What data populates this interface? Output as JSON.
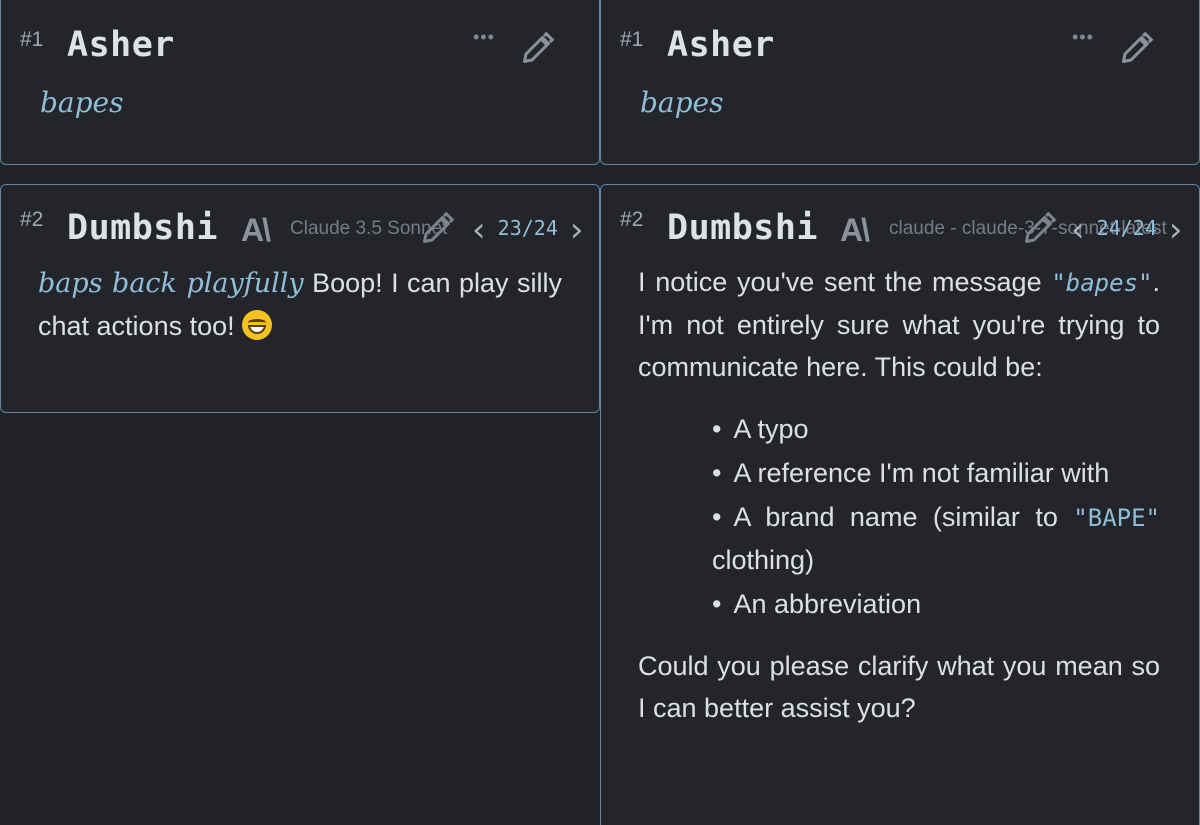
{
  "messages": [
    {
      "index": "#1",
      "author": "Asher",
      "text": "bapes",
      "more_label": "•••"
    },
    {
      "index": "#2",
      "author": "Dumbshi",
      "left": {
        "model_logo": "A\\",
        "model": "Claude 3.5 Sonnet",
        "nav": "23/24",
        "action": "baps back playfully",
        "text": "Boop! I can play silly chat actions too!"
      },
      "right": {
        "model_logo": "A\\",
        "model": "claude - claude-3-7-sonnet-latest",
        "nav": "24/24",
        "intro_1": "I notice you've sent the message ",
        "intro_code": "\"bapes\"",
        "intro_2": ". I'm not entirely sure what you're trying to communicate here. This could be:",
        "bullets": [
          "A typo",
          "A reference I'm not familiar with",
          "A brand name (similar to ",
          "An abbreviation"
        ],
        "bullet_code": "\"BAPE\"",
        "bullet_code_after": " clothing)",
        "closing": "Could you please clarify what you mean so I can better assist you?"
      }
    }
  ],
  "icons": {
    "edit": "pencil-icon",
    "more": "more-options-icon",
    "prev": "chevron-left-icon",
    "next": "chevron-right-icon",
    "emoji": "grinning-face-emoji"
  },
  "colors": {
    "background": "#23232a",
    "card_border": "#5f86a6",
    "accent": "#8fbfd8"
  }
}
